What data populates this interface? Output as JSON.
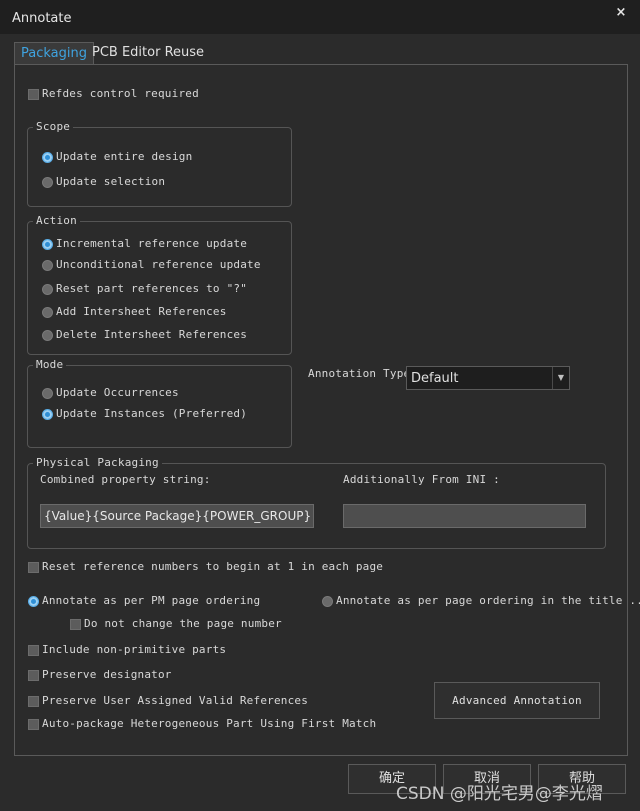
{
  "window": {
    "title": "Annotate",
    "close_glyph": "×"
  },
  "tabs": [
    {
      "label": "Packaging",
      "active": true
    },
    {
      "label": "PCB Editor Reuse",
      "active": false
    }
  ],
  "refdes_control": {
    "label": "Refdes control required",
    "checked": false
  },
  "scope": {
    "legend": "Scope",
    "options": [
      {
        "label": "Update entire design",
        "selected": true
      },
      {
        "label": "Update selection",
        "selected": false
      }
    ]
  },
  "action": {
    "legend": "Action",
    "options": [
      {
        "label": "Incremental reference update",
        "selected": true
      },
      {
        "label": "Unconditional reference update",
        "selected": false
      },
      {
        "label": "Reset part references to \"?\"",
        "selected": false
      },
      {
        "label": "Add Intersheet References",
        "selected": false
      },
      {
        "label": "Delete Intersheet References",
        "selected": false
      }
    ]
  },
  "mode": {
    "legend": "Mode",
    "options": [
      {
        "label": "Update Occurrences",
        "selected": false
      },
      {
        "label": "Update Instances (Preferred)",
        "selected": true
      }
    ]
  },
  "annotation_type": {
    "label": "Annotation Type",
    "value": "Default"
  },
  "physical_packaging": {
    "legend": "Physical Packaging",
    "combined_label": "Combined property string:",
    "combined_value": "{Value}{Source Package}{POWER_GROUP}",
    "additional_label": "Additionally From INI :",
    "additional_value": ""
  },
  "options": {
    "reset_numbers": "Reset reference numbers to begin at 1 in each page",
    "annotate_pm": "Annotate as per PM page ordering",
    "annotate_title": "Annotate as per page ordering in the title ...",
    "no_change_page": "Do not change the page number",
    "include_non_primitive": "Include non-primitive parts",
    "preserve_designator": "Preserve designator",
    "preserve_user_refs": "Preserve User Assigned Valid References",
    "auto_package": "Auto-package Heterogeneous Part Using First Match"
  },
  "buttons": {
    "advanced": "Advanced Annotation",
    "ok": "确定",
    "cancel": "取消",
    "help": "帮助"
  },
  "watermark": "CSDN @阳光宅男@李光熠"
}
